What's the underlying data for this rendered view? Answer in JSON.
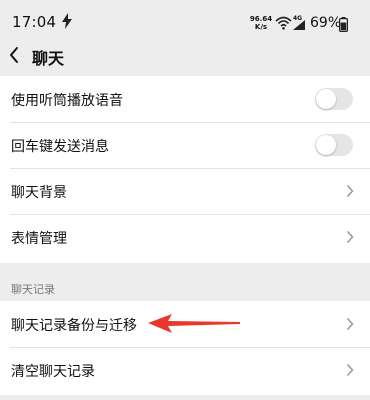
{
  "status_bar": {
    "time": "17:04",
    "net_speed_value": "96.64",
    "net_speed_unit": "K/s",
    "signal_label": "4G",
    "battery_percent": "69%",
    "charging": true
  },
  "nav": {
    "title": "聊天"
  },
  "settings_group": {
    "items": [
      {
        "label": "使用听筒播放语音",
        "control": "toggle",
        "on": false
      },
      {
        "label": "回车键发送消息",
        "control": "toggle",
        "on": false
      },
      {
        "label": "聊天背景",
        "control": "chevron"
      },
      {
        "label": "表情管理",
        "control": "chevron"
      }
    ]
  },
  "history_section": {
    "header": "聊天记录",
    "items": [
      {
        "label": "聊天记录备份与迁移",
        "control": "chevron"
      },
      {
        "label": "清空聊天记录",
        "control": "chevron"
      }
    ]
  },
  "colors": {
    "background": "#ededed",
    "card": "#ffffff",
    "toggle_off": "#e5e5e5",
    "annotation_arrow": "#e8382b"
  },
  "icons": {
    "back": "chevron-left-icon",
    "row_action": "chevron-right-icon",
    "annotation": "red-arrow-annotation"
  }
}
